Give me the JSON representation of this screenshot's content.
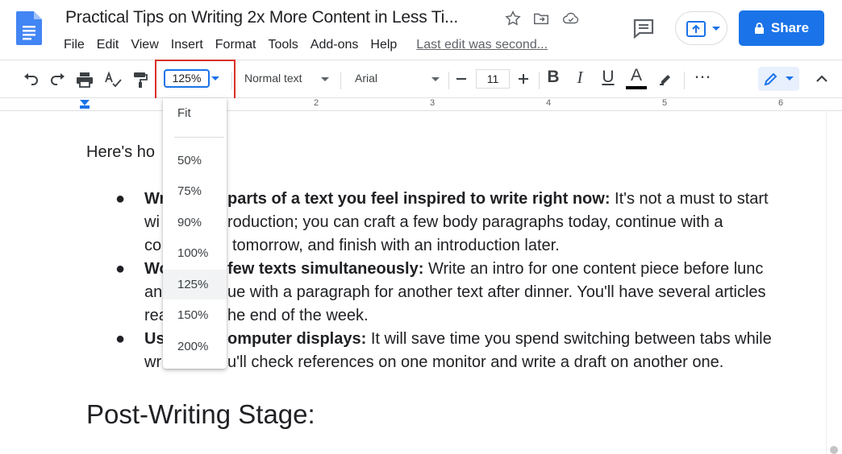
{
  "doc": {
    "title": "Practical Tips on Writing 2x More Content in Less Ti...",
    "last_edit": "Last edit was second..."
  },
  "menu": [
    "File",
    "Edit",
    "View",
    "Insert",
    "Format",
    "Tools",
    "Add-ons",
    "Help"
  ],
  "share_label": "Share",
  "toolbar": {
    "zoom": "125%",
    "style": "Normal text",
    "font": "Arial",
    "font_size": "11",
    "bold": "B",
    "italic": "I",
    "underline": "U",
    "text_color": "A",
    "more": "⋯"
  },
  "ruler": [
    "2",
    "3",
    "4",
    "5",
    "6"
  ],
  "zoom_menu": {
    "options": [
      "Fit",
      "50%",
      "75%",
      "90%",
      "100%",
      "125%",
      "150%",
      "200%"
    ],
    "selected": "125%"
  },
  "content": {
    "intro": "Here's ho",
    "bullet": "●",
    "bullets": [
      {
        "lines": [
          {
            "bold": "Wr",
            "rest": ""
          },
          {
            "bold": "",
            "rest": "wi"
          },
          {
            "bold": "",
            "rest": "co"
          }
        ],
        "right_lines": [
          {
            "bold": "parts of a text you feel inspired to write right now:",
            "rest": " It's not a must to start"
          },
          {
            "bold": "",
            "rest": "roduction; you can craft a few body paragraphs today, continue with a"
          },
          {
            "bold": "",
            "rest": "tomorrow, and finish with an introduction later."
          }
        ]
      },
      {
        "lines": [
          {
            "bold": "Wo",
            "rest": ""
          },
          {
            "bold": "",
            "rest": "an"
          },
          {
            "bold": "",
            "rest": "rea"
          }
        ],
        "right_lines": [
          {
            "bold": "few texts simultaneously:",
            "rest": " Write an intro for one content piece before lunc"
          },
          {
            "bold": "",
            "rest": "ue with a paragraph for another text after dinner. You'll have several articles"
          },
          {
            "bold": "",
            "rest": "he end of the week."
          }
        ]
      },
      {
        "lines": [
          {
            "bold": "Us",
            "rest": ""
          },
          {
            "bold": "",
            "rest": "wr"
          }
        ],
        "right_lines": [
          {
            "bold": "omputer displays:",
            "rest": " It will save time you spend switching between tabs while"
          },
          {
            "bold": "",
            "rest": "u'll check references on one monitor and write a draft on another one."
          }
        ]
      }
    ],
    "heading": "Post-Writing Stage:"
  },
  "colors": {
    "accent": "#1a73e8",
    "highlight_box": "#d93025",
    "docs_blue": "#4285f4"
  }
}
